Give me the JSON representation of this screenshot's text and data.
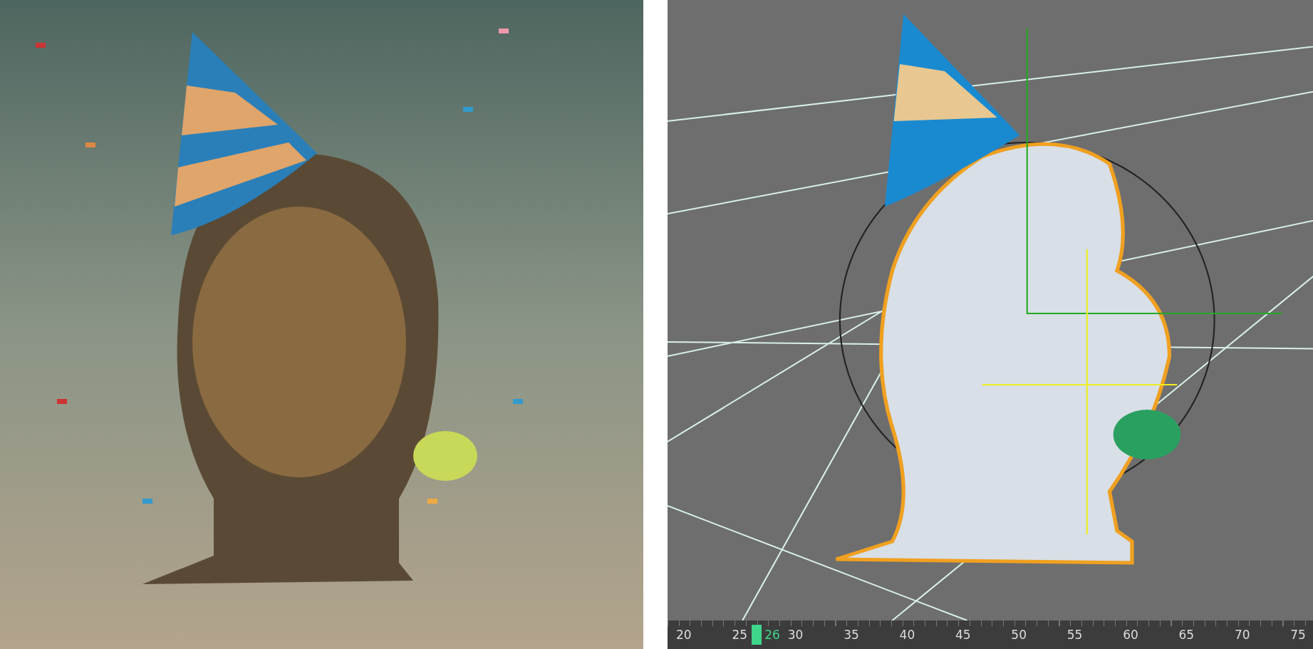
{
  "timeline": {
    "ticks": [
      "20",
      "25",
      "30",
      "35",
      "40",
      "45",
      "50",
      "55",
      "60",
      "65",
      "70",
      "75"
    ],
    "current_frame": "26",
    "level": 0.124
  }
}
